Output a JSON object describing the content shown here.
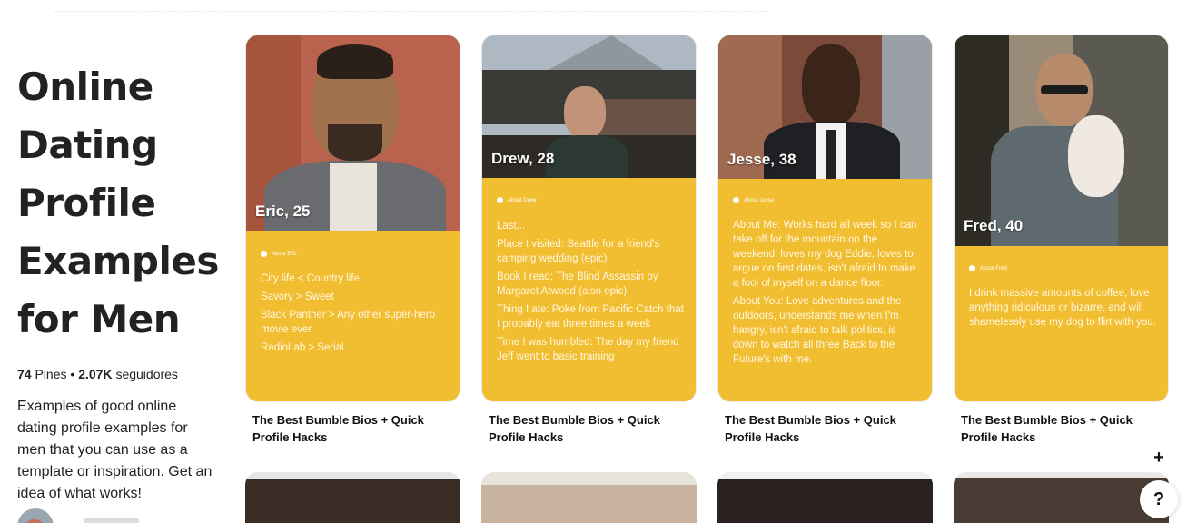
{
  "board": {
    "title": "Online Dating Profile Examples for Men",
    "pins_count": "74",
    "pins_label": "Pines",
    "separator": "•",
    "followers_count": "2.07K",
    "followers_label": "seguidores",
    "description": "Examples of good online dating profile examples for men that you can use as a template or inspiration. Get an idea of what works!"
  },
  "pins": [
    {
      "name": "Eric, 25",
      "about_label": "About Eric",
      "bio": [
        "City life < Country life",
        "Savory > Sweet",
        "Black Panther > Any other super-hero movie ever",
        "RadioLab > Serial"
      ],
      "title": "The Best Bumble Bios + Quick Profile Hacks"
    },
    {
      "name": "Drew, 28",
      "about_label": "About Drew",
      "bio": [
        "Last...",
        "Place I visited: Seattle for a friend's camping wedding (epic)",
        "Book I read: The Blind Assassin by Margaret Atwood (also epic)",
        "Thing I ate: Poke from Pacific Catch that I probably eat three times a week",
        "Time I was humbled: The day my friend Jeff went to basic training"
      ],
      "title": "The Best Bumble Bios + Quick Profile Hacks"
    },
    {
      "name": "Jesse, 38",
      "about_label": "About Jesse",
      "bio": [
        "About Me: Works hard all week so I can take off for the mountain on the weekend, loves my dog Eddie, loves to argue on first dates, isn't afraid to make a fool of myself on a dance floor.",
        "About You: Love adventures and the outdoors, understands me when I'm hangry, isn't afraid to talk politics, is down to watch all three Back to the Future's with me."
      ],
      "title": "The Best Bumble Bios + Quick Profile Hacks"
    },
    {
      "name": "Fred, 40",
      "about_label": "About Fred",
      "bio": [
        "I drink massive amounts of coffee, love anything ridiculous or bizarre, and will shamelessly use my dog to flirt with you."
      ],
      "title": "The Best Bumble Bios + Quick Profile Hacks"
    }
  ],
  "floating": {
    "add_label": "+",
    "help_label": "?"
  },
  "colors": {
    "card_yellow": "#f1bd31",
    "text_dark": "#222222"
  }
}
